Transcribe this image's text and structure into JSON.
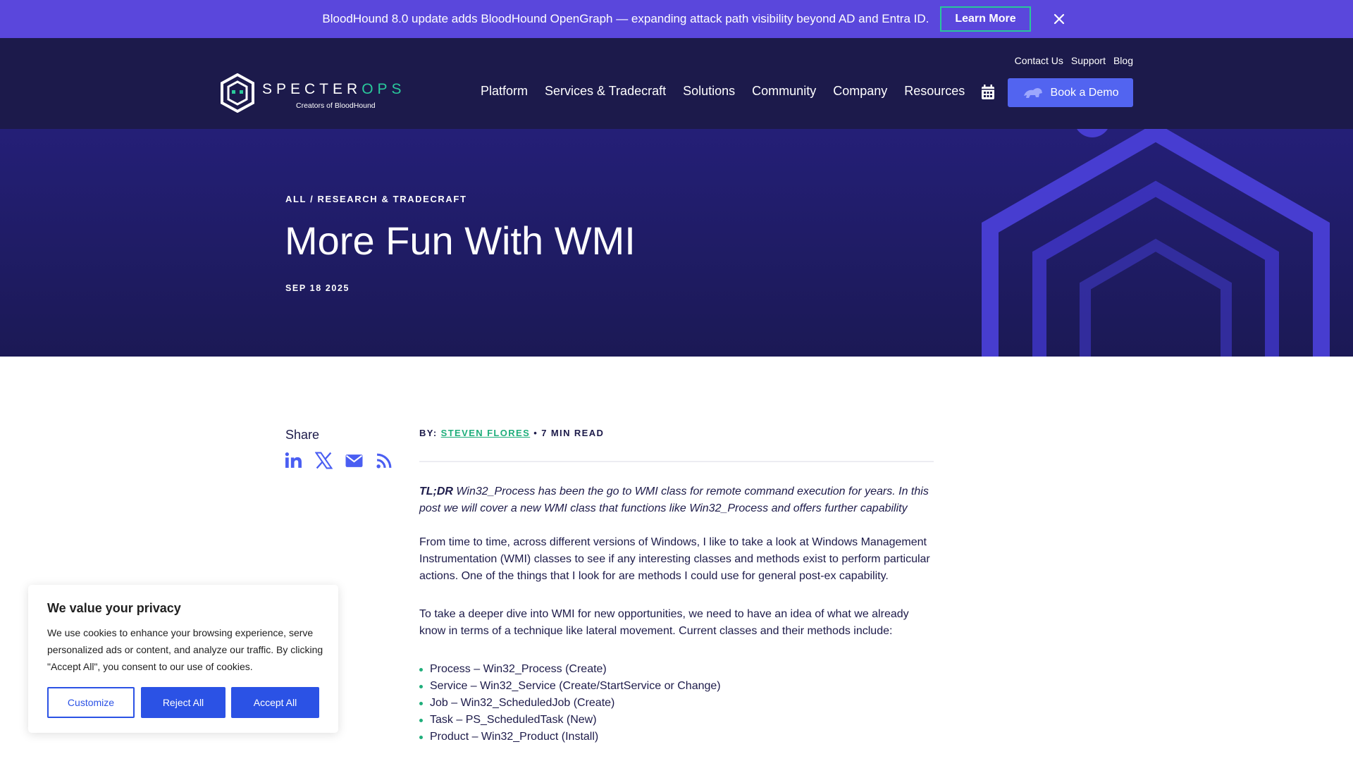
{
  "announcement": {
    "text": "BloodHound 8.0 update adds BloodHound OpenGraph — expanding attack path visibility beyond AD and Entra ID.",
    "cta_label": "Learn More",
    "close_icon": "close-icon"
  },
  "header": {
    "logo": {
      "word_main": "SPECTER",
      "word_accent": "OPS",
      "tagline": "Creators of BloodHound"
    },
    "top_links": [
      "Contact Us",
      "Support",
      "Blog"
    ],
    "nav": [
      "Platform",
      "Services & Tradecraft",
      "Solutions",
      "Community",
      "Company",
      "Resources"
    ],
    "calendar_icon": "calendar-icon",
    "demo_button": "Book a Demo"
  },
  "hero": {
    "breadcrumb": {
      "all": "All",
      "separator": "/",
      "category": "Research & Tradecraft"
    },
    "title": "More Fun With WMI",
    "date": "SEP 18 2025"
  },
  "share": {
    "title": "Share",
    "icons": [
      "linkedin-icon",
      "x-icon",
      "email-icon",
      "rss-icon"
    ]
  },
  "article": {
    "meta": {
      "by": "BY:",
      "author": "STEVEN FLORES",
      "bullet": "•",
      "read_time": "7 MIN READ"
    },
    "tldr_label": "TL;DR",
    "tldr_text": " Win32_Process has been the go to WMI class for remote command execution for years. In this post we will cover a new WMI class that functions like Win32_Process and offers further capability",
    "para1": "From time to time, across different versions of Windows, I like to take a look at Windows Management Instrumentation (WMI) classes to see if any interesting classes and methods exist to perform particular actions. One of the things that I look for are methods I could use for general post-ex capability.",
    "para2": "To take a deeper dive into WMI for new opportunities, we need to have an idea of what we already know in terms of a technique like lateral movement. Current classes and their methods include:",
    "list": [
      "Process – Win32_Process (Create)",
      "Service – Win32_Service (Create/StartService or Change)",
      "Job – Win32_ScheduledJob (Create)",
      "Task – PS_ScheduledTask (New)",
      "Product – Win32_Product (Install)"
    ]
  },
  "cookie": {
    "title": "We value your privacy",
    "text": "We use cookies to enhance your browsing experience, serve personalized ads or content, and analyze our traffic. By clicking \"Accept All\", you consent to our use of cookies.",
    "customize": "Customize",
    "reject": "Reject All",
    "accept": "Accept All"
  },
  "colors": {
    "announce_bg": "#5a47dc",
    "header_bg": "#1c1a4b",
    "hero_bg": "#241f77",
    "accent_green": "#1fae7b",
    "button_blue": "#5264f0",
    "cookie_blue": "#2b52e5"
  }
}
